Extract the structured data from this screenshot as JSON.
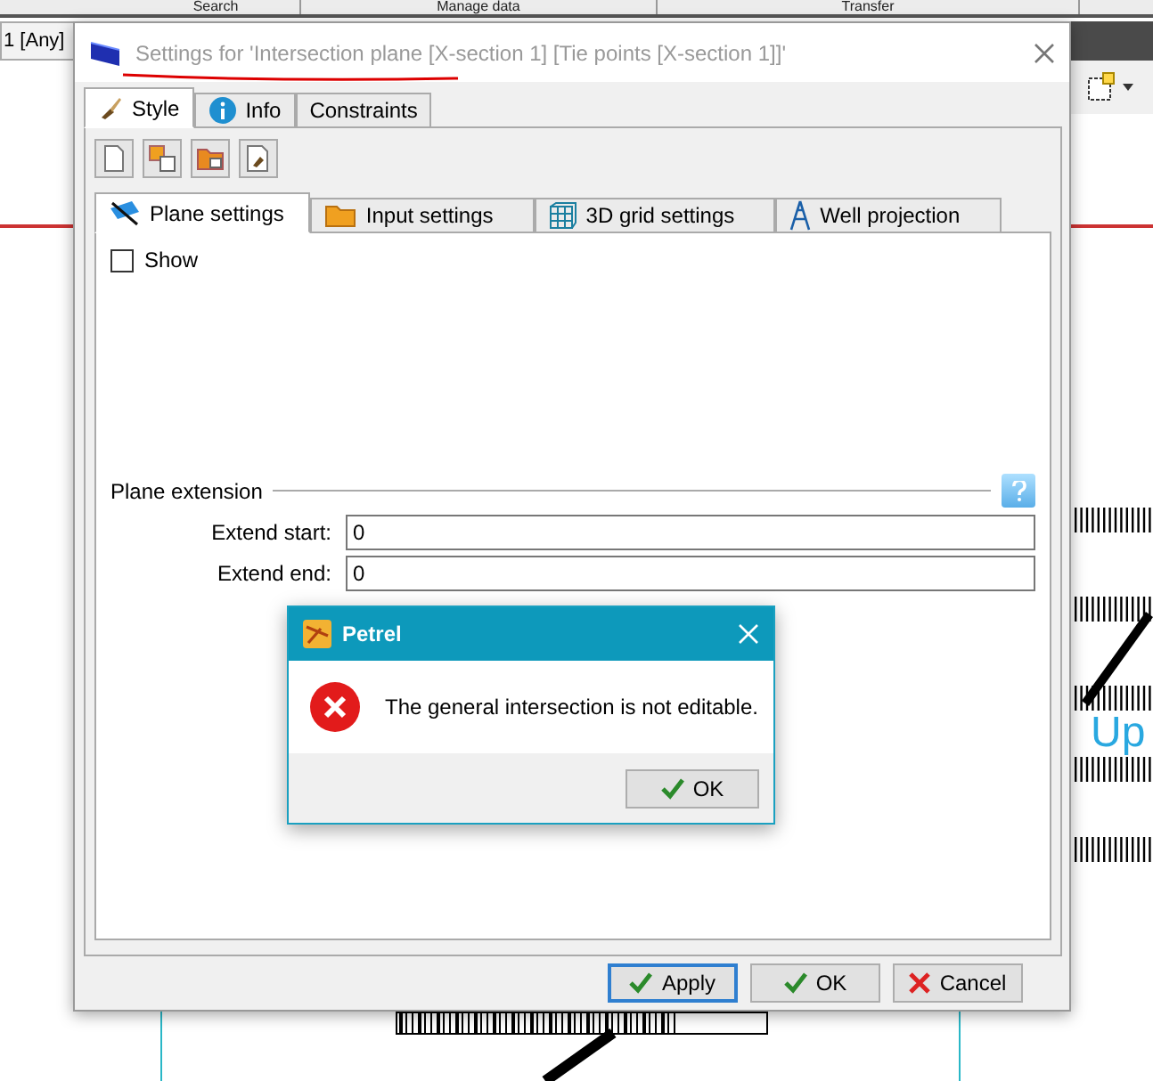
{
  "background_app": {
    "menu_tabs": [
      "Search",
      "Manage data",
      "Transfer"
    ],
    "filter_label": "1 [Any]",
    "canvas_text": "Up"
  },
  "settings_dialog": {
    "title": "Settings for 'Intersection plane [X-section 1] [Tie points [X-section 1]]'",
    "tabs": [
      {
        "label": "Style",
        "kind": "brush",
        "selected": true
      },
      {
        "label": "Info",
        "kind": "info",
        "selected": false
      },
      {
        "label": "Constraints",
        "kind": "none",
        "selected": false
      }
    ],
    "subtabs": [
      {
        "label": "Plane settings",
        "kind": "plane",
        "selected": true
      },
      {
        "label": "Input settings",
        "kind": "folder",
        "selected": false
      },
      {
        "label": "3D grid settings",
        "kind": "grid",
        "selected": false
      },
      {
        "label": "Well projection",
        "kind": "tower",
        "selected": false
      }
    ],
    "show": {
      "label": "Show",
      "checked": false
    },
    "plane_extension": {
      "heading": "Plane extension",
      "fields": [
        {
          "label": "Extend start:",
          "value": "0"
        },
        {
          "label": "Extend end:",
          "value": "0"
        }
      ]
    },
    "buttons": [
      {
        "label": "Apply",
        "kind": "check",
        "focused": true
      },
      {
        "label": "OK",
        "kind": "check",
        "focused": false
      },
      {
        "label": "Cancel",
        "kind": "cross",
        "focused": false
      }
    ]
  },
  "message_box": {
    "title": "Petrel",
    "message": "The general intersection is not editable.",
    "button": "OK"
  }
}
